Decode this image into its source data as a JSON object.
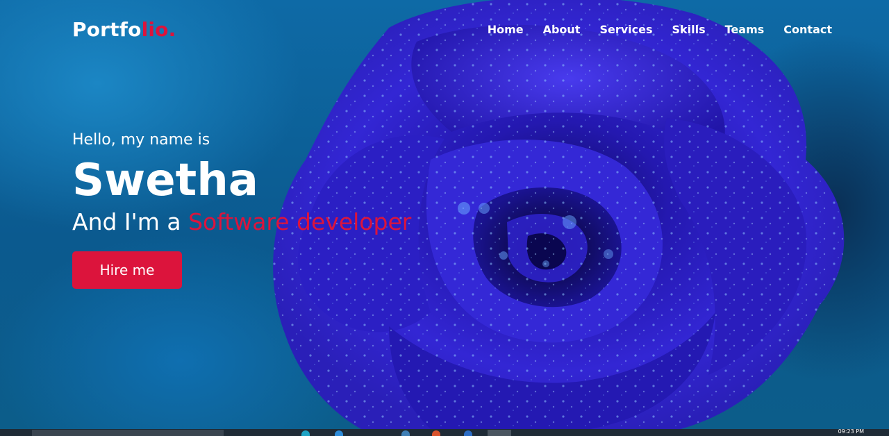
{
  "brand": {
    "logo_main": "Portfo",
    "logo_accent": "lio."
  },
  "nav": {
    "items": [
      {
        "label": "Home"
      },
      {
        "label": "About"
      },
      {
        "label": "Services"
      },
      {
        "label": "Skills"
      },
      {
        "label": "Teams"
      },
      {
        "label": "Contact"
      }
    ]
  },
  "hero": {
    "greeting": "Hello, my name is",
    "name": "Swetha",
    "role_prefix": "And I'm a ",
    "role_highlight": "Software developer",
    "button_label": "Hire me",
    "background_image": "blue-rose-with-water-droplets"
  },
  "taskbar": {
    "clock": "09:23 PM"
  },
  "colors": {
    "accent": "#dc143c",
    "text": "#ffffff",
    "background": "#0b5f93",
    "rose": "#2a1fc0"
  }
}
